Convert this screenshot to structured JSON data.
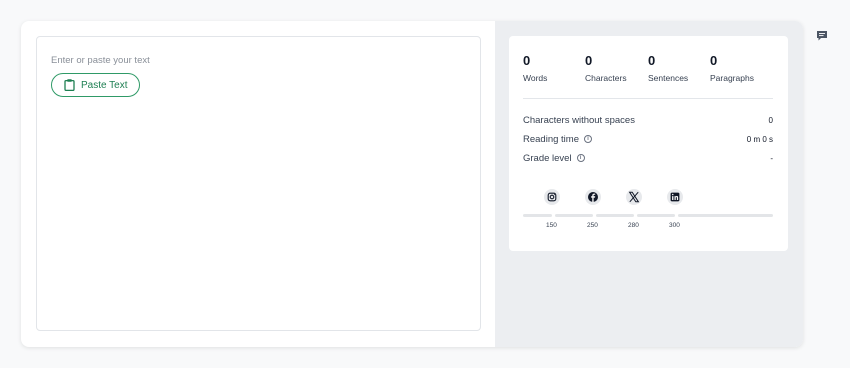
{
  "editor": {
    "placeholder": "Enter or paste your text",
    "paste_label": "Paste Text"
  },
  "counts": [
    {
      "value": "0",
      "label": "Words"
    },
    {
      "value": "0",
      "label": "Characters"
    },
    {
      "value": "0",
      "label": "Sentences"
    },
    {
      "value": "0",
      "label": "Paragraphs"
    }
  ],
  "metrics": {
    "chars_no_spaces": {
      "label": "Characters without spaces",
      "value": "0"
    },
    "reading_time": {
      "label": "Reading time",
      "value": "0 m 0 s"
    },
    "grade_level": {
      "label": "Grade level",
      "value": "-"
    }
  },
  "social": [
    {
      "name": "instagram-icon",
      "limit": "150",
      "progress": 0
    },
    {
      "name": "facebook-icon",
      "limit": "250",
      "progress": 0
    },
    {
      "name": "x-icon",
      "limit": "280",
      "progress": 0
    },
    {
      "name": "linkedin-icon",
      "limit": "300",
      "progress": 0
    }
  ],
  "colors": {
    "accent": "#2f9a67",
    "panel": "#eceef1"
  }
}
